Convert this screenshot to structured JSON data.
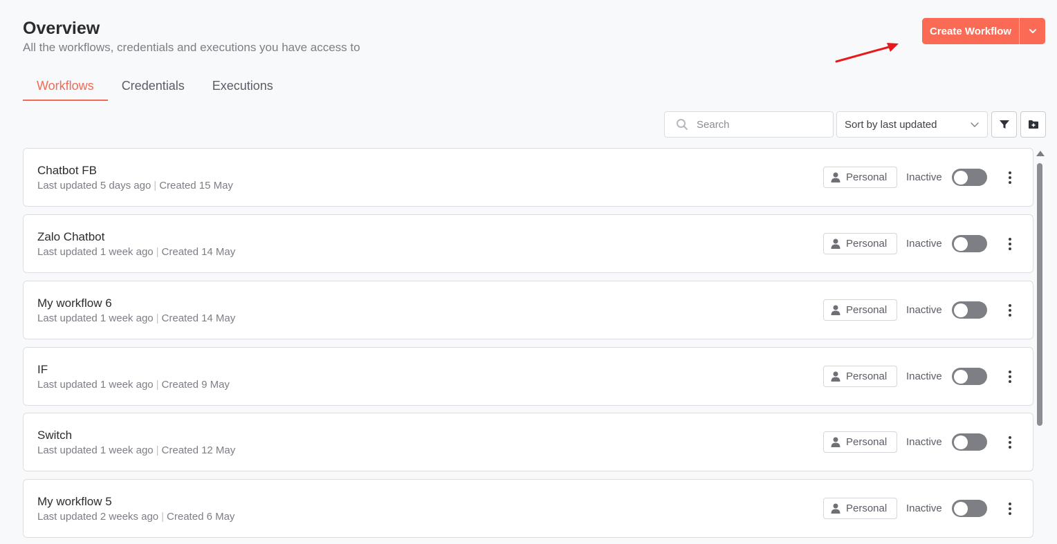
{
  "header": {
    "title": "Overview",
    "subtitle": "All the workflows, credentials and executions you have access to"
  },
  "create": {
    "label": "Create Workflow",
    "color": "#fa6a55"
  },
  "tabs": [
    {
      "label": "Workflows",
      "active": true
    },
    {
      "label": "Credentials",
      "active": false
    },
    {
      "label": "Executions",
      "active": false
    }
  ],
  "toolbar": {
    "search_placeholder": "Search",
    "sort_label": "Sort by last updated"
  },
  "workflows": [
    {
      "name": "Chatbot FB",
      "updated": "Last updated 5 days ago",
      "created": "Created 15 May",
      "owner": "Personal",
      "status": "Inactive"
    },
    {
      "name": "Zalo Chatbot",
      "updated": "Last updated 1 week ago",
      "created": "Created 14 May",
      "owner": "Personal",
      "status": "Inactive"
    },
    {
      "name": "My workflow 6",
      "updated": "Last updated 1 week ago",
      "created": "Created 14 May",
      "owner": "Personal",
      "status": "Inactive"
    },
    {
      "name": "IF",
      "updated": "Last updated 1 week ago",
      "created": "Created 9 May",
      "owner": "Personal",
      "status": "Inactive"
    },
    {
      "name": "Switch",
      "updated": "Last updated 1 week ago",
      "created": "Created 12 May",
      "owner": "Personal",
      "status": "Inactive"
    },
    {
      "name": "My workflow 5",
      "updated": "Last updated 2 weeks ago",
      "created": "Created 6 May",
      "owner": "Personal",
      "status": "Inactive"
    }
  ],
  "icons": {
    "search": "search-icon",
    "sort": "chevron-down-icon",
    "filter": "filter-icon",
    "new_folder": "folder-plus-icon",
    "owner": "user-icon",
    "actions": "kebab-icon"
  }
}
